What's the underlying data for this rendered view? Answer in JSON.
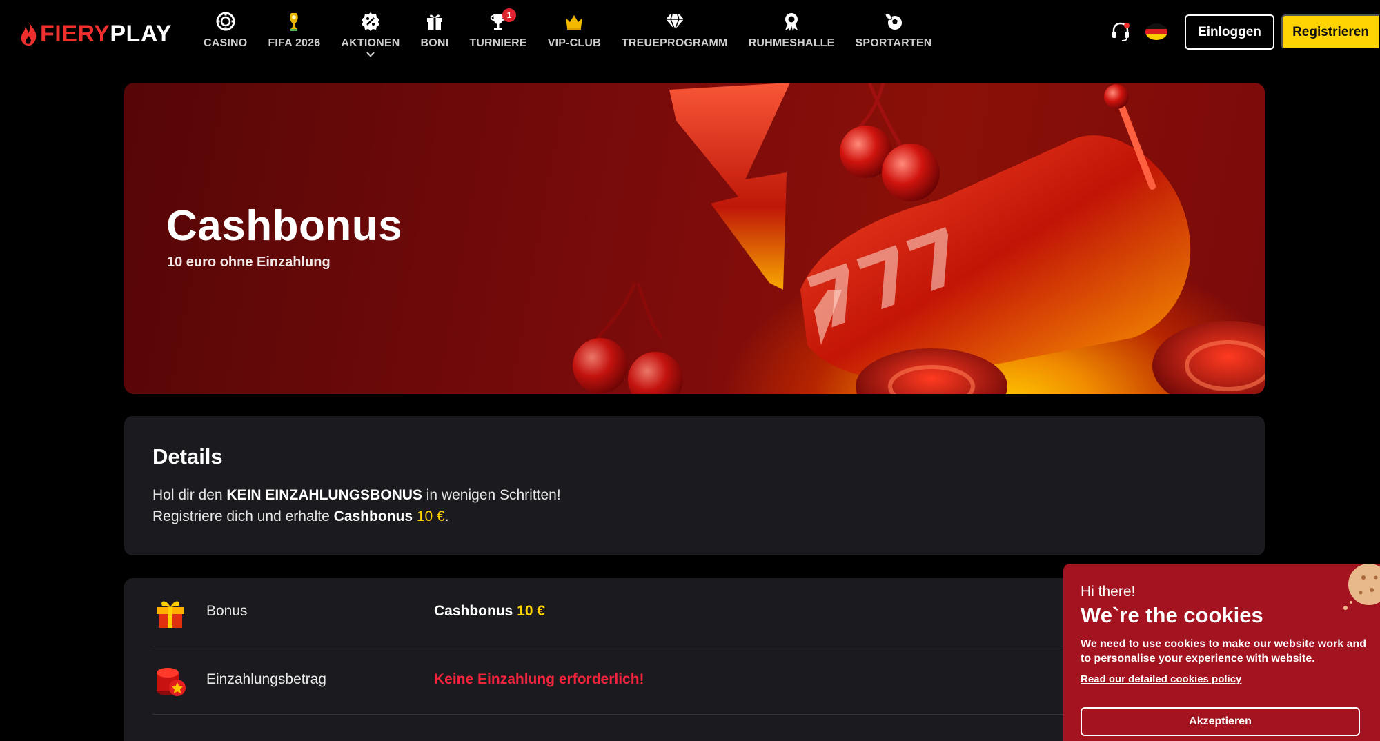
{
  "brand": {
    "part1": "FIERY",
    "part2": "PLAY"
  },
  "nav": [
    {
      "label": "CASINO",
      "icon": "casino-chip-icon"
    },
    {
      "label": "FIFA 2026",
      "icon": "trophy-icon"
    },
    {
      "label": "AKTIONEN",
      "icon": "discount-badge-icon",
      "has_dropdown": true
    },
    {
      "label": "BONI",
      "icon": "gift-icon"
    },
    {
      "label": "TURNIERE",
      "icon": "tournament-cup-icon",
      "badge": "1"
    },
    {
      "label": "VIP-CLUB",
      "icon": "crown-icon"
    },
    {
      "label": "TREUEPROGRAMM",
      "icon": "diamond-icon"
    },
    {
      "label": "RUHMESHALLE",
      "icon": "medal-icon"
    },
    {
      "label": "SPORTARTEN",
      "icon": "sports-ball-icon"
    }
  ],
  "header_actions": {
    "login": "Einloggen",
    "register": "Registrieren",
    "language_flag": "german-flag-icon"
  },
  "hero": {
    "title": "Cashbonus",
    "subtitle": "10 euro ohne Einzahlung"
  },
  "details": {
    "title": "Details",
    "line1": {
      "pre": "Hol dir den ",
      "bold": "KEIN EINZAHLUNGSBONUS",
      "post": " in wenigen Schritten!"
    },
    "line2": {
      "pre": "Registriere dich und erhalte ",
      "bold": "Cashbonus",
      "amount": " 10 €",
      "post": "."
    }
  },
  "info_rows": [
    {
      "label": "Bonus",
      "value_bold": "Cashbonus",
      "value_amount": " 10 €",
      "icon": "gift-box-icon"
    },
    {
      "label": "Einzahlungsbetrag",
      "value_alert": "Keine Einzahlung erforderlich!",
      "icon": "coin-stack-icon"
    }
  ],
  "cookie": {
    "greeting": "Hi there!",
    "title": "We`re the cookies",
    "text": "We need to use cookies to make our website work and to personalise your experience with website.",
    "link": "Read our detailed cookies policy",
    "accept": "Akzeptieren"
  },
  "colors": {
    "accent_yellow": "#ffd400",
    "brand_red": "#ef2e2e",
    "cookie_bg": "#a31420",
    "card_bg": "#1a1a1f",
    "alert_red": "#f0243a"
  }
}
